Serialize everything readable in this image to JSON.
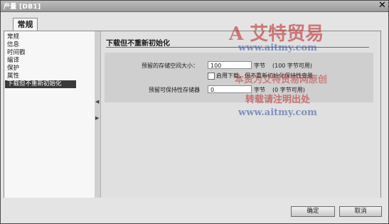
{
  "window": {
    "title": "产量 [DB1]",
    "close_symbol": "✕"
  },
  "tabs": [
    {
      "label": "常规"
    }
  ],
  "nav": {
    "items": [
      {
        "label": "常规"
      },
      {
        "label": "信息"
      },
      {
        "label": "时间戳"
      },
      {
        "label": "编译"
      },
      {
        "label": "保护"
      },
      {
        "label": "属性"
      },
      {
        "label": "下载但不重新初始化"
      }
    ]
  },
  "section": {
    "title": "下载但不重新初始化",
    "reserved_memory": {
      "label": "预留的存储空间大小：",
      "value": "100",
      "unit": "字节",
      "hint": "(100 字节可用)"
    },
    "enable_download": {
      "label": "启用下载，但不重新初始化保持性变量",
      "checked": false
    },
    "reserved_retain": {
      "label": "预留可保持性存储器",
      "value": "0",
      "unit": "字节",
      "hint": "(0 字节可用)"
    }
  },
  "buttons": {
    "ok": "确定",
    "cancel": "取消"
  },
  "watermark": {
    "brand": "A 艾特贸易",
    "url": "www.aitmy.com",
    "line1": "本资为艾特贸易网原创",
    "line2": "转载请注明出处",
    "url2": "www.aitmy.com"
  },
  "colors": {
    "active_nav": "#3a3a3a",
    "watermark_red": "#c03030",
    "watermark_blue": "#3050a0"
  }
}
